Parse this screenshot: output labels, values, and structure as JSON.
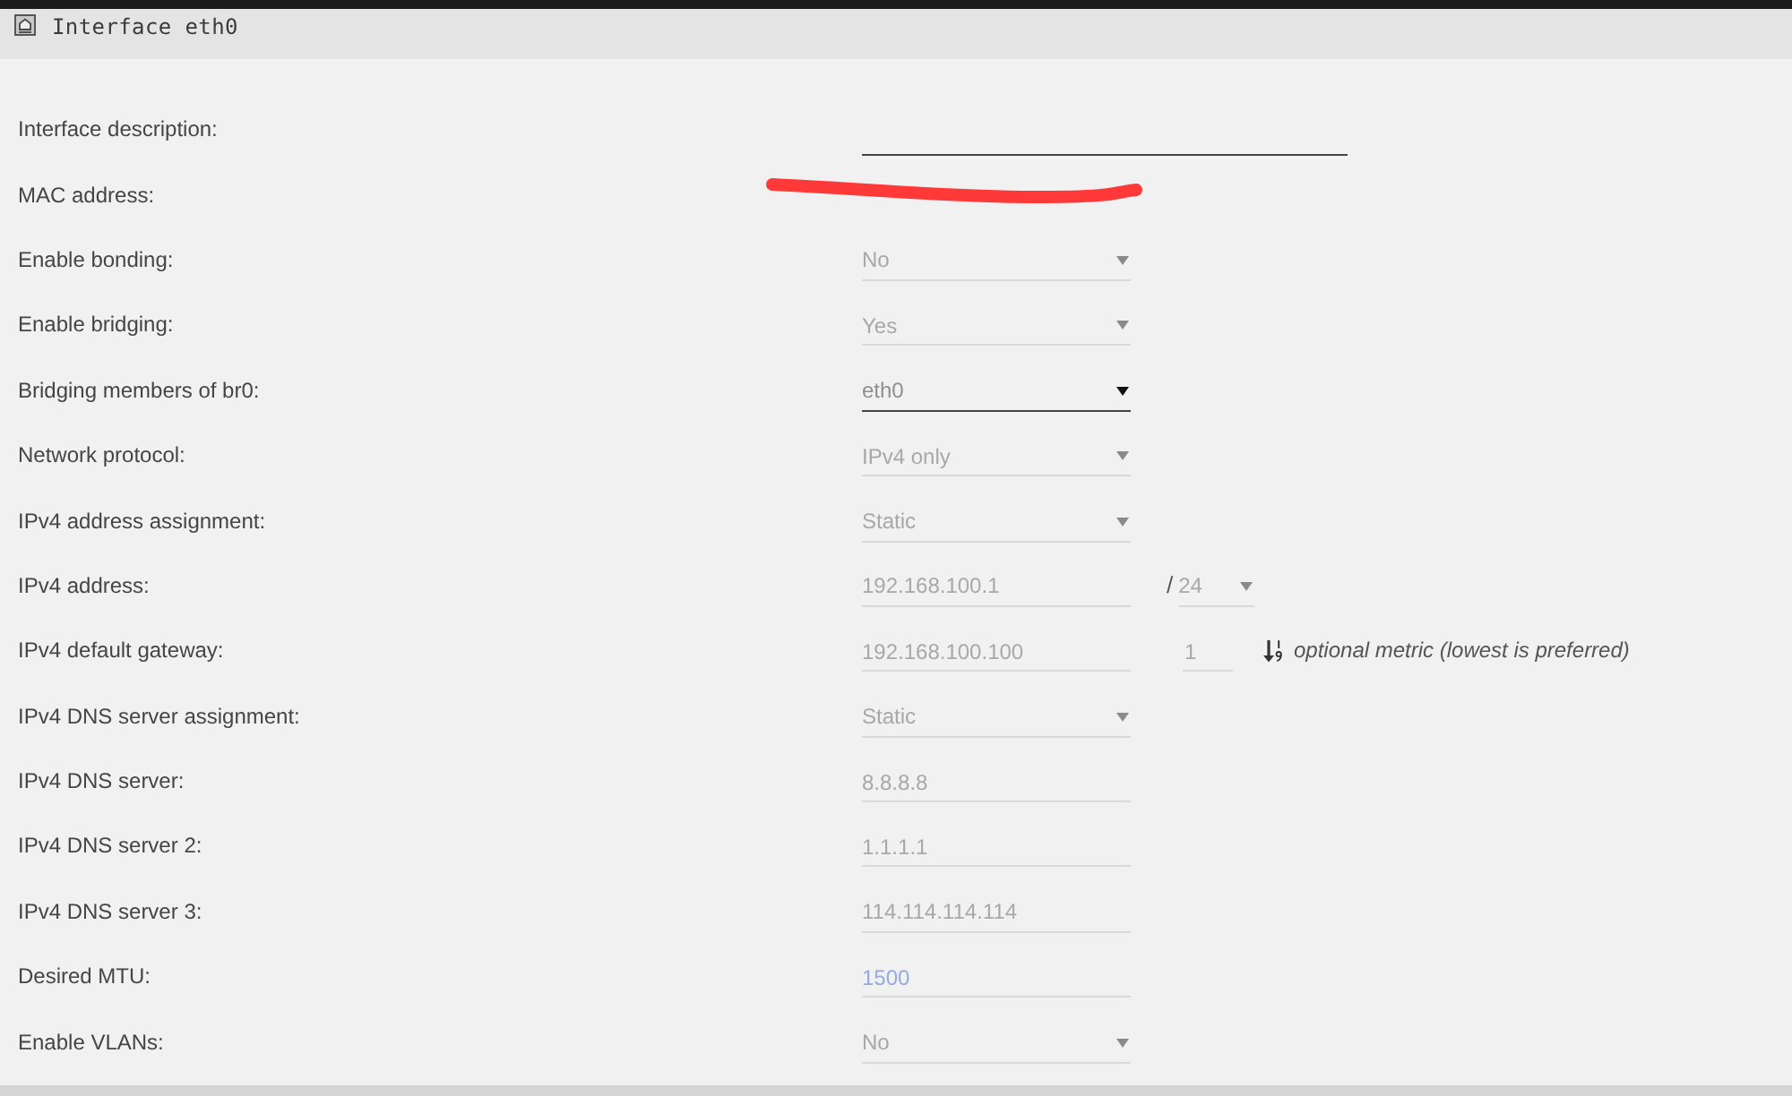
{
  "window": {
    "title": "Interface eth0"
  },
  "fields": [
    {
      "label": "Interface description:",
      "kind": "longtext",
      "disabled": false
    },
    {
      "label": "MAC address:",
      "kind": "redacted"
    },
    {
      "label": "Enable bonding:",
      "kind": "select",
      "value": "No",
      "disabled": true
    },
    {
      "label": "Enable bridging:",
      "kind": "select",
      "value": "Yes",
      "disabled": true
    },
    {
      "label": "Bridging members of br0:",
      "kind": "select",
      "value": "eth0",
      "disabled": false
    },
    {
      "label": "Network protocol:",
      "kind": "select",
      "value": "IPv4 only",
      "disabled": true
    },
    {
      "label": "IPv4 address assignment:",
      "kind": "select",
      "value": "Static",
      "disabled": true
    },
    {
      "label": "IPv4 address:",
      "kind": "text",
      "value": "192.168.100.1",
      "disabled": true,
      "prefix": {
        "separator": "/",
        "value": "24",
        "disabled": true
      }
    },
    {
      "label": "IPv4 default gateway:",
      "kind": "text",
      "value": "192.168.100.100",
      "disabled": true,
      "metric": {
        "value": "1",
        "disabled": true,
        "hint": "optional metric (lowest is preferred)"
      }
    },
    {
      "label": "IPv4 DNS server assignment:",
      "kind": "select",
      "value": "Static",
      "disabled": true
    },
    {
      "label": "IPv4 DNS server:",
      "kind": "text",
      "value": "8.8.8.8",
      "disabled": true
    },
    {
      "label": "IPv4 DNS server 2:",
      "kind": "text",
      "value": "1.1.1.1",
      "disabled": true
    },
    {
      "label": "IPv4 DNS server 3:",
      "kind": "text",
      "value": "114.114.114.114",
      "disabled": true
    },
    {
      "label": "Desired MTU:",
      "kind": "text",
      "placeholder": "1500",
      "disabled": true
    },
    {
      "label": "Enable VLANs:",
      "kind": "select",
      "value": "No",
      "disabled": true
    }
  ]
}
